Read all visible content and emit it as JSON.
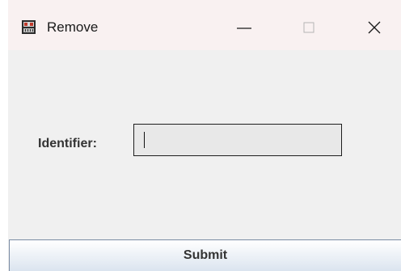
{
  "window": {
    "title": "Remove",
    "controls": {
      "minimize": "minimize-icon",
      "maximize": "maximize-icon",
      "close": "close-icon"
    }
  },
  "form": {
    "identifier_label": "Identifier:",
    "identifier_value": "",
    "identifier_placeholder": "",
    "submit_label": "Submit"
  },
  "colors": {
    "titlebar": "#f9f1f1",
    "content_bg": "#f0f0f0",
    "input_bg": "#e8e8e8",
    "button_gradient_bottom": "#dbe4ef"
  }
}
